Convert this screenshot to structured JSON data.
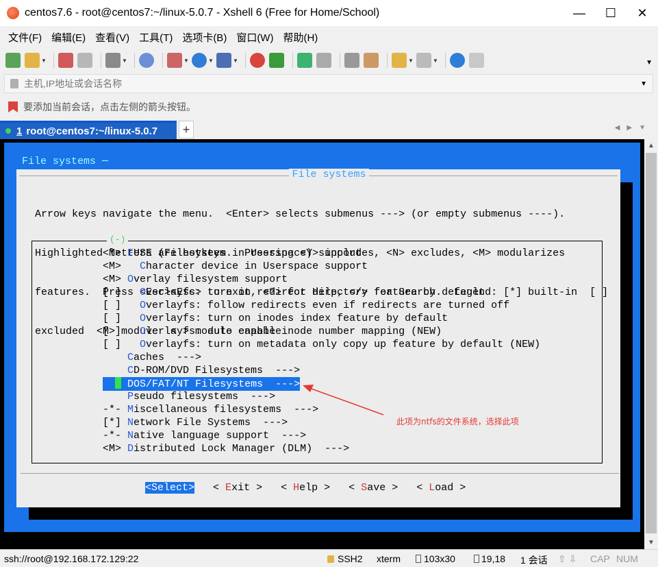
{
  "window": {
    "title": "centos7.6 - root@centos7:~/linux-5.0.7 - Xshell 6 (Free for Home/School)",
    "controls": [
      "—",
      "☐",
      "✕"
    ]
  },
  "menu": [
    "文件(F)",
    "编辑(E)",
    "查看(V)",
    "工具(T)",
    "选项卡(B)",
    "窗口(W)",
    "帮助(H)"
  ],
  "address": {
    "placeholder": "主机,IP地址或会话名称"
  },
  "hint": "要添加当前会话，点击左侧的箭头按钮。",
  "tab": {
    "number": "1",
    "label": "root@centos7:~/linux-5.0.7",
    "add": "+"
  },
  "terminal": {
    "bg_title": "File systems ─",
    "dialog_title": "File systems",
    "help_lines": [
      "Arrow keys navigate the menu.  <Enter> selects submenus ---> (or empty submenus ----).",
      "Highlighted letters are hotkeys.  Pressing <Y> includes, <N> excludes, <M> modularizes",
      "features.  Press <Esc><Esc> to exit, <?> for Help, </> for Search.  Legend: [*] built-in  [ ]",
      "excluded  <M> module  < > module capable"
    ],
    "scroll_indicator": "(-)",
    "items": [
      {
        "prefix": "<M> ",
        "indent": "",
        "hot": "F",
        "rest": "USE (Filesystem in Userspace) support"
      },
      {
        "prefix": "<M> ",
        "indent": "  ",
        "hot": "C",
        "rest": "haracter device in Userspace support"
      },
      {
        "prefix": "<M> ",
        "indent": "",
        "hot": "O",
        "rest": "verlay filesystem support"
      },
      {
        "prefix": "[ ] ",
        "indent": "  ",
        "hot": "O",
        "rest": "verlayfs: turn on redirect directory feature by default"
      },
      {
        "prefix": "[ ] ",
        "indent": "  ",
        "hot": "O",
        "rest": "verlayfs: follow redirects even if redirects are turned off"
      },
      {
        "prefix": "[ ] ",
        "indent": "  ",
        "hot": "O",
        "rest": "verlayfs: turn on inodes index feature by default"
      },
      {
        "prefix": "[ ] ",
        "indent": "  ",
        "hot": "O",
        "rest": "verlayfs: auto enable inode number mapping (NEW)"
      },
      {
        "prefix": "[ ] ",
        "indent": "  ",
        "hot": "O",
        "rest": "verlayfs: turn on metadata only copy up feature by default (NEW)"
      },
      {
        "prefix": "    ",
        "indent": "",
        "hot": "C",
        "rest": "aches  --->"
      },
      {
        "prefix": "    ",
        "indent": "",
        "hot": "C",
        "rest": "D-ROM/DVD Filesystems  --->"
      },
      {
        "prefix": "    ",
        "indent": "",
        "hot": "D",
        "rest": "OS/FAT/NT Filesystems  --->",
        "selected": true
      },
      {
        "prefix": "    ",
        "indent": "",
        "hot": "P",
        "rest": "seudo filesystems  --->"
      },
      {
        "prefix": "-*- ",
        "indent": "",
        "hot": "M",
        "rest": "iscellaneous filesystems  --->"
      },
      {
        "prefix": "[*] ",
        "indent": "",
        "hot": "N",
        "rest": "etwork File Systems  --->"
      },
      {
        "prefix": "-*- ",
        "indent": "",
        "hot": "N",
        "rest": "ative language support  --->"
      },
      {
        "prefix": "<M> ",
        "indent": "",
        "hot": "D",
        "rest": "istributed Lock Manager (DLM)  --->"
      }
    ],
    "buttons": {
      "select": "<Select>",
      "exit_pre": "< ",
      "exit_hot": "E",
      "exit_rest": "xit >",
      "help_pre": "< ",
      "help_hot": "H",
      "help_rest": "elp >",
      "save_pre": "< ",
      "save_hot": "S",
      "save_rest": "ave >",
      "load_pre": "< ",
      "load_hot": "L",
      "load_rest": "oad >"
    }
  },
  "annotation": "此项为ntfs的文件系统，选择此项",
  "status": {
    "connection": "ssh://root@192.168.172.129:22",
    "protocol": "SSH2",
    "term": "xterm",
    "size": "103x30",
    "cursor": "19,18",
    "sessions": "1 会话",
    "caps": "CAP",
    "num": "NUM"
  },
  "colors": {
    "tab_active": "#1e62c5",
    "terminal_blue": "#1a73e8",
    "annotation": "#e53935"
  }
}
